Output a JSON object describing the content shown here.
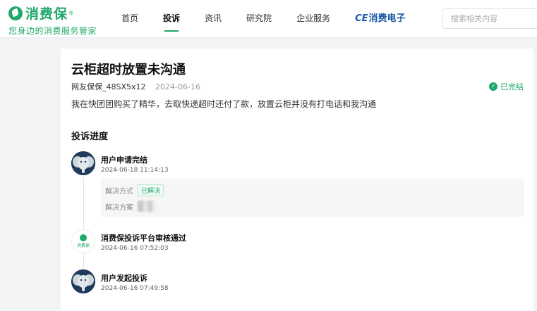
{
  "header": {
    "logo_text": "消费保",
    "logo_reg": "®",
    "slogan": "您身边的消费服务管家",
    "nav": [
      {
        "label": "首页",
        "active": false
      },
      {
        "label": "投诉",
        "active": true
      },
      {
        "label": "资讯",
        "active": false
      },
      {
        "label": "研究院",
        "active": false
      },
      {
        "label": "企业服务",
        "active": false
      }
    ],
    "brand_ce": "CE",
    "brand_cn": "消费电子",
    "search_placeholder": "搜索相关内容"
  },
  "complaint": {
    "title": "云柜超时放置未沟通",
    "user": "网友保保_48SX5x12",
    "date": "2024-06-16",
    "status": "已完结",
    "content": "我在快团团购买了精华，去取快递超时还付了款，放置云柜并没有打电话和我沟通"
  },
  "progress": {
    "title": "投诉进度",
    "steps": [
      {
        "title": "用户申请完结",
        "time": "2024-06-18 11:14:13",
        "avatar": "elephant-avatar"
      },
      {
        "title": "消费保投诉平台审核通过",
        "time": "2024-06-16 07:52:03",
        "avatar": "xiaofeibao-logo",
        "avatar_text": "消费保"
      },
      {
        "title": "用户发起投诉",
        "time": "2024-06-16 07:49:58",
        "avatar": "elephant-avatar"
      }
    ],
    "resolution": {
      "method_label": "解决方式",
      "method_value": "已解决",
      "plan_label": "解决方案"
    }
  },
  "colors": {
    "accent": "#1fa86a",
    "brand_blue": "#1a5aa8",
    "avatar_bg": "#1f3a5a"
  }
}
